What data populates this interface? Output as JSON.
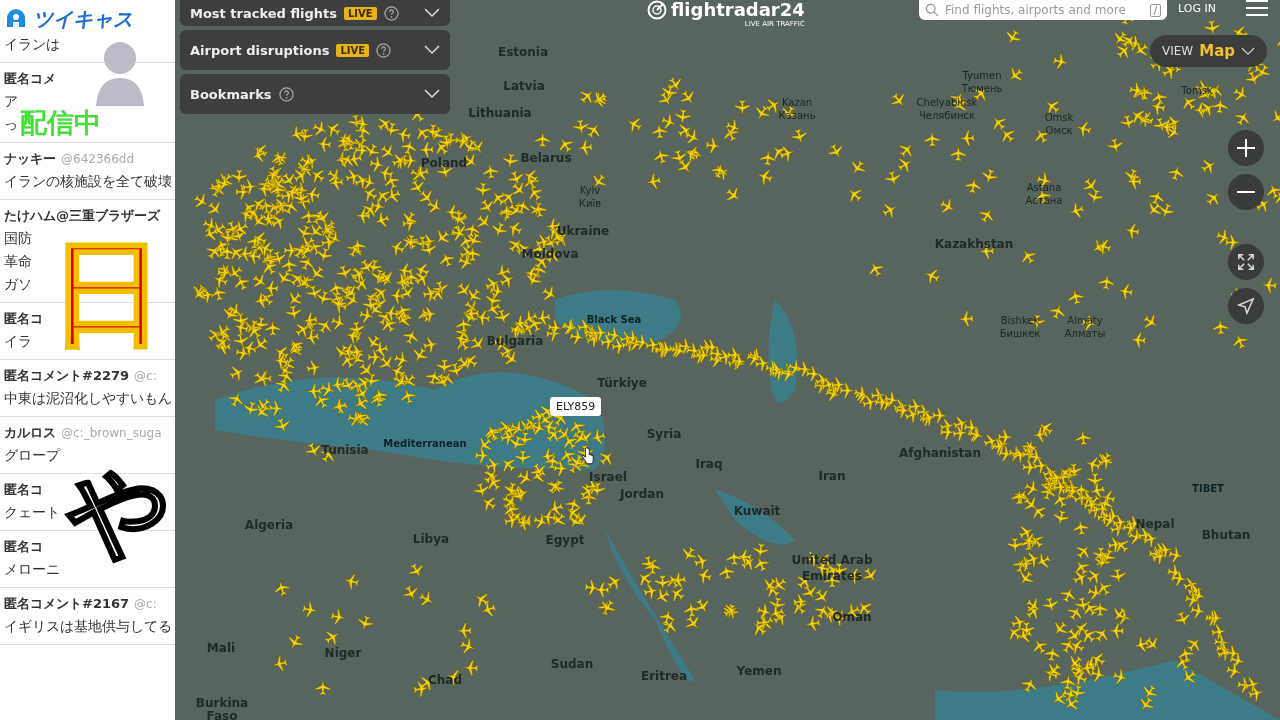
{
  "comments_panel": {
    "comments": [
      {
        "lines": [
          "イランは"
        ]
      },
      {
        "name": "匿名コメ",
        "lines": [
          "ア",
          "っ"
        ]
      },
      {
        "name": "ナッキー",
        "handle": "@642366dd",
        "lines": [
          "イランの核施設を全て破壊"
        ]
      },
      {
        "name": "たけハム@三重ブラザーズ",
        "lines": [
          "国防",
          "革命",
          "ガソ"
        ]
      },
      {
        "name": "匿名コ",
        "lines": [
          "イラ"
        ]
      },
      {
        "name": "匿名コメント#2279",
        "handle": "@c:",
        "lines": [
          "中東は泥沼化しやすいもん"
        ]
      },
      {
        "name": "カルロス",
        "handle": "@c:_brown_suga",
        "lines": [
          "グロープ"
        ]
      },
      {
        "name": "匿名コ",
        "lines": [
          "クェート"
        ]
      },
      {
        "name": "匿名コ",
        "lines": [
          "メローニ"
        ]
      },
      {
        "name": "匿名コメント#2167",
        "handle": "@c:",
        "lines": [
          "イギリスは基地供与してる"
        ]
      }
    ]
  },
  "stream_overlay": {
    "logo": "ツイキャス",
    "status": "配信中",
    "big_chars": [
      "日",
      "や"
    ]
  },
  "map": {
    "logo": "flightradar24",
    "tagline": "LIVE AIR TRAFFIC",
    "search": {
      "placeholder": "Find flights, airports and more",
      "shortcut": "/"
    },
    "login": "LOG IN",
    "view": {
      "label": "VIEW",
      "value": "Map"
    },
    "panels": [
      {
        "title": "Most tracked flights",
        "badge": "LIVE",
        "expanded": false
      },
      {
        "title": "Airport disruptions",
        "badge": "LIVE",
        "expanded": false
      },
      {
        "title": "Bookmarks",
        "expanded": false
      }
    ],
    "labels": [
      {
        "text": "Estonia",
        "kind": "country"
      },
      {
        "text": "Latvia",
        "kind": "country"
      },
      {
        "text": "Lithuania",
        "kind": "country"
      },
      {
        "text": "Belarus",
        "kind": "country"
      },
      {
        "text": "Poland",
        "kind": "country"
      },
      {
        "text": "Kyiv",
        "kind": "city"
      },
      {
        "text": "Київ",
        "kind": "city"
      },
      {
        "text": "Ukraine",
        "kind": "country"
      },
      {
        "text": "Moldova",
        "kind": "country"
      },
      {
        "text": "Bulgaria",
        "kind": "country"
      },
      {
        "text": "Black Sea",
        "kind": "sea"
      },
      {
        "text": "Türkiye",
        "kind": "country"
      },
      {
        "text": "Syria",
        "kind": "country"
      },
      {
        "text": "Iraq",
        "kind": "country"
      },
      {
        "text": "Iran",
        "kind": "country"
      },
      {
        "text": "Kuwait",
        "kind": "country"
      },
      {
        "text": "Jordan",
        "kind": "country"
      },
      {
        "text": "Israel",
        "kind": "country"
      },
      {
        "text": "Egypt",
        "kind": "country"
      },
      {
        "text": "Libya",
        "kind": "country"
      },
      {
        "text": "Algeria",
        "kind": "country"
      },
      {
        "text": "Tunisia",
        "kind": "country"
      },
      {
        "text": "Mediterranean",
        "kind": "sea"
      },
      {
        "text": "Mali",
        "kind": "country"
      },
      {
        "text": "Niger",
        "kind": "country"
      },
      {
        "text": "Chad",
        "kind": "country"
      },
      {
        "text": "Sudan",
        "kind": "country"
      },
      {
        "text": "Eritrea",
        "kind": "country"
      },
      {
        "text": "Yemen",
        "kind": "country"
      },
      {
        "text": "United Arab",
        "kind": "country"
      },
      {
        "text": "Emirates",
        "kind": "country"
      },
      {
        "text": "Oman",
        "kind": "country"
      },
      {
        "text": "Kazakhstan",
        "kind": "country"
      },
      {
        "text": "Afghanistan",
        "kind": "country"
      },
      {
        "text": "Nepal",
        "kind": "country"
      },
      {
        "text": "Bhutan",
        "kind": "country"
      },
      {
        "text": "TIBET",
        "kind": "sea"
      },
      {
        "text": "Kazan",
        "kind": "city"
      },
      {
        "text": "Казань",
        "kind": "city"
      },
      {
        "text": "Tyumen",
        "kind": "city"
      },
      {
        "text": "Тюмень",
        "kind": "city"
      },
      {
        "text": "Chelyabinsk",
        "kind": "city"
      },
      {
        "text": "Челябинск",
        "kind": "city"
      },
      {
        "text": "Omsk",
        "kind": "city"
      },
      {
        "text": "Омск",
        "kind": "city"
      },
      {
        "text": "Tomsk",
        "kind": "city"
      },
      {
        "text": "Astana",
        "kind": "city"
      },
      {
        "text": "Астана",
        "kind": "city"
      },
      {
        "text": "Bishkek",
        "kind": "city"
      },
      {
        "text": "Бишкек",
        "kind": "city"
      },
      {
        "text": "Almaty",
        "kind": "city"
      },
      {
        "text": "Алматы",
        "kind": "city"
      },
      {
        "text": "Burkina",
        "kind": "country"
      },
      {
        "text": "Faso",
        "kind": "country"
      }
    ],
    "tooltip": "ELY859"
  }
}
